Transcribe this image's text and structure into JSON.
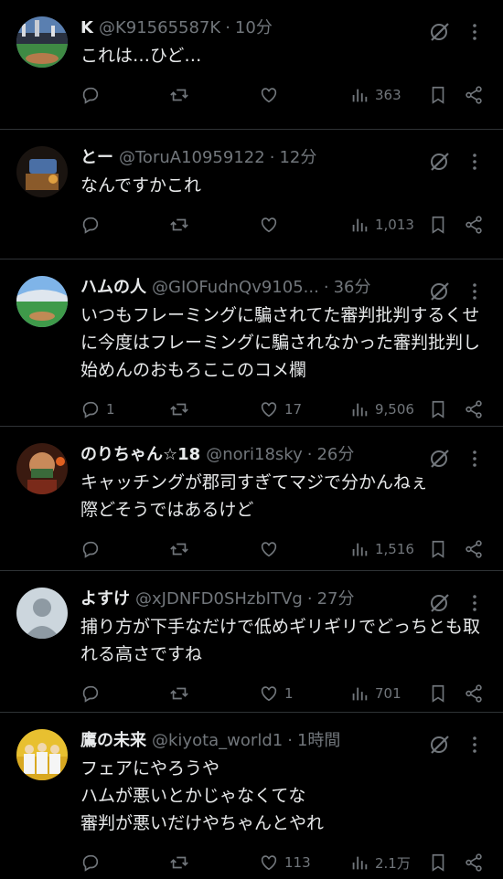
{
  "tweets": [
    {
      "name": "K",
      "handle": "@K91565587K",
      "time": "10分",
      "text": "これは…ひど…",
      "replies": "",
      "retweets": "",
      "likes": "",
      "views": "363",
      "avatar": "stadium-night-icon"
    },
    {
      "name": "とー",
      "handle": "@ToruA10959122",
      "time": "12分",
      "text": "なんですかこれ",
      "replies": "",
      "retweets": "",
      "likes": "",
      "views": "1,013",
      "avatar": "dark-room-icon"
    },
    {
      "name": "ハムの人",
      "handle": "@GIOFudnQv9105...",
      "time": "36分",
      "text": "いつもフレーミングに騙されてた審判批判するくせに今度はフレーミングに騙されなかった審判批判し始めんのおもろここのコメ欄",
      "replies": "1",
      "retweets": "",
      "likes": "17",
      "views": "9,506",
      "avatar": "stadium-day-icon"
    },
    {
      "name": "のりちゃん☆18",
      "handle": "@nori18sky",
      "time": "26分",
      "text": "キャッチングが郡司すぎてマジで分かんねぇ\n際どそうではあるけど",
      "replies": "",
      "retweets": "",
      "likes": "",
      "views": "1,516",
      "avatar": "masked-face-icon"
    },
    {
      "name": "よすけ",
      "handle": "@xJDNFD0SHzbITVg",
      "time": "27分",
      "text": "捕り方が下手なだけで低めギリギリでどっちとも取れる高さですね",
      "replies": "",
      "retweets": "",
      "likes": "1",
      "views": "701",
      "avatar": "default-user-icon"
    },
    {
      "name": "鷹の未来",
      "handle": "@kiyota_world1",
      "time": "1時間",
      "text": "フェアにやろうや\nハムが悪いとかじゃなくてな\n審判が悪いだけやちゃんとやれ",
      "replies": "",
      "retweets": "",
      "likes": "113",
      "views": "2.1万",
      "avatar": "team-photo-icon"
    }
  ]
}
